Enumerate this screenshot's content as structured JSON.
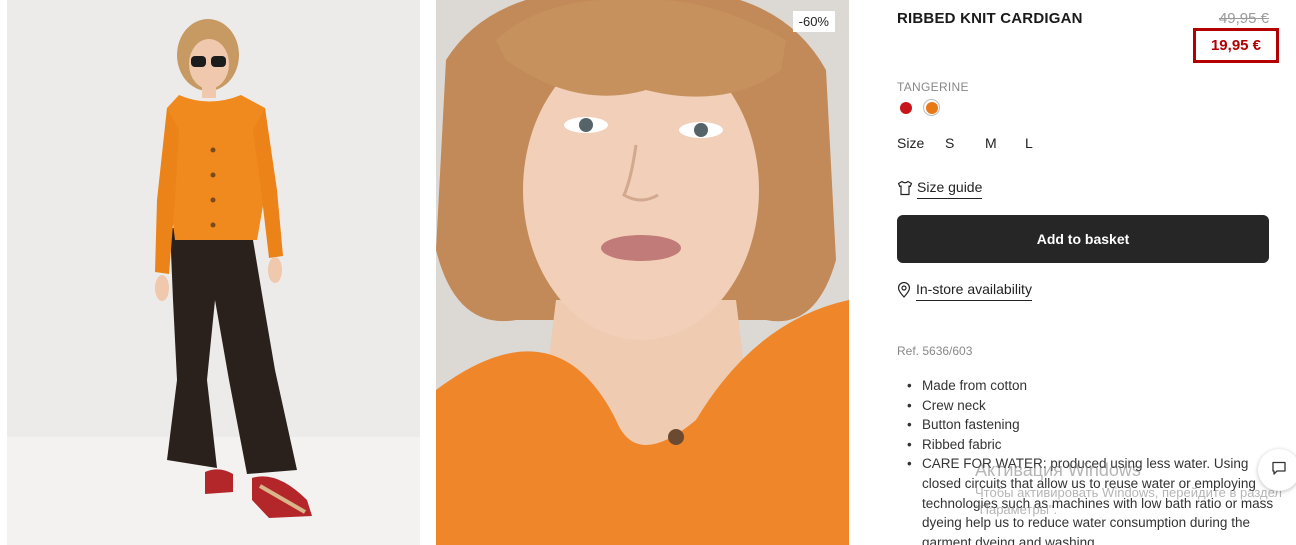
{
  "product": {
    "title": "RIBBED KNIT CARDIGAN",
    "old_price": "49,95 €",
    "new_price": "19,95 €",
    "discount_badge": "-60%",
    "color_name": "TANGERINE",
    "swatches": [
      {
        "name": "red",
        "color": "#c8151b"
      },
      {
        "name": "tangerine",
        "color": "#e97817",
        "selected": true
      }
    ],
    "size_label": "Size",
    "sizes": [
      "S",
      "M",
      "L"
    ],
    "size_guide": "Size guide",
    "add_to_basket": "Add to basket",
    "in_store": "In-store availability",
    "ref": "Ref. 5636/603",
    "features": [
      "Made from cotton",
      "Crew neck",
      "Button fastening",
      "Ribbed fabric",
      "CARE FOR WATER: produced using less water. Using closed circuits that allow us to reuse water or employing technologies such as machines with low bath ratio or mass dyeing help us to reduce water consumption during the garment dyeing and washing"
    ]
  },
  "watermark": {
    "line1": "Активация Windows",
    "line2": "Чтобы активировать Windows, перейдите в раздел \"Параметры\"."
  },
  "colors": {
    "accent_red": "#b30000",
    "button_dark": "#262626",
    "cardigan_orange": "#f08a1e"
  }
}
